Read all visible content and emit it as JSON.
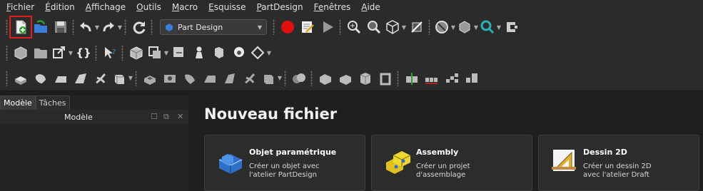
{
  "menubar": {
    "items": [
      {
        "first": "F",
        "rest": "ichier"
      },
      {
        "first": "É",
        "rest": "dition"
      },
      {
        "first": "A",
        "rest": "ffichage"
      },
      {
        "first": "O",
        "rest": "utils"
      },
      {
        "first": "M",
        "rest": "acro"
      },
      {
        "first": "E",
        "rest": "squisse"
      },
      {
        "first": "P",
        "rest": "artDesign"
      },
      {
        "first": "Fe",
        "rest": "nêtres"
      },
      {
        "first": "A",
        "rest": "ide"
      }
    ]
  },
  "toolbar": {
    "workbench_selector": "Part Design",
    "accent": "#e02020"
  },
  "left_panel": {
    "tabs": [
      "Modèle",
      "Tâches"
    ],
    "header_title": "Modèle"
  },
  "start_page": {
    "title": "Nouveau fichier",
    "cards": [
      {
        "title": "Objet paramétrique",
        "desc_line1": "Créer un objet avec",
        "desc_line2": "l'atelier PartDesign"
      },
      {
        "title": "Assembly",
        "desc_line1": "Créer un projet",
        "desc_line2": "d'assemblage"
      },
      {
        "title": "Dessin 2D",
        "desc_line1": "Créer un dessin 2D",
        "desc_line2": "avec l'atelier Draft"
      }
    ]
  }
}
